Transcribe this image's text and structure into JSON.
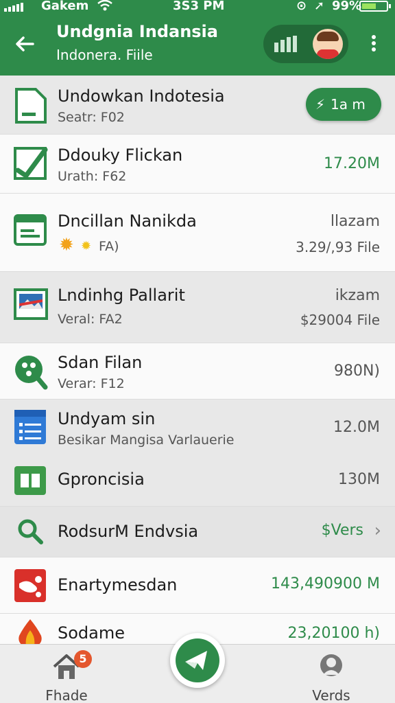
{
  "status_bar": {
    "carrier": "Gakem",
    "time": "3S3 PM",
    "battery": "99%"
  },
  "header": {
    "title": "Undgnia Indansia",
    "subtitle": "Indonera. Fiile"
  },
  "colors": {
    "primary": "#2e8b4a",
    "primary_dark": "#226a38",
    "badge": "#e4572e"
  },
  "rows": [
    {
      "icon": "document-icon",
      "name": "Undowkan Indotesia",
      "sub": "Seatr: F02",
      "pill_label": "1a m"
    },
    {
      "icon": "checkmark-icon",
      "name": "Ddouky Flickan",
      "sub": "Urath: F62",
      "value": "17.20M"
    },
    {
      "icon": "spreadsheet-icon",
      "name": "Dncillan Nanikda",
      "sub": "FA)",
      "value": "llazam",
      "value2": "3.29/,93 File"
    },
    {
      "icon": "image-icon",
      "name": "Lndinhg Pallarit",
      "sub": "Veral: FA2",
      "value": "ikzam",
      "value2": "$29004 File"
    },
    {
      "icon": "search-dots-icon",
      "name": "Sdan Filan",
      "sub": "Verar: F12",
      "value": "980N)"
    },
    {
      "icon": "form-icon",
      "name": "Undyam sin",
      "sub": "Besikar Mangisa Varlauerie",
      "value": "12.0M"
    },
    {
      "icon": "sheets-icon",
      "name": "Gproncisia",
      "value": "130M"
    },
    {
      "icon": "magnifier-icon",
      "name": "RodsurM Endvsia",
      "value": "$Vers"
    },
    {
      "icon": "app-red-icon",
      "name": "Enartymesdan",
      "value": "143,490900 M"
    },
    {
      "icon": "flame-icon",
      "name": "Sodame",
      "value": "23,20100 h)"
    }
  ],
  "bottom_nav": {
    "home_label": "Fhade",
    "home_badge": "5",
    "verds_label": "Verds"
  }
}
